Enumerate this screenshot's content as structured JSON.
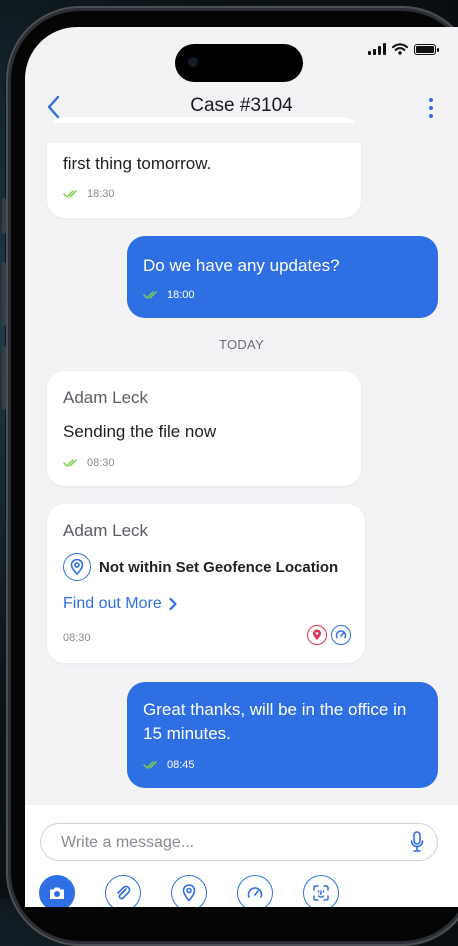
{
  "header": {
    "title": "Case #3104"
  },
  "messages": [
    {
      "direction": "incoming",
      "text": "first thing tomorrow.",
      "time": "18:30"
    },
    {
      "direction": "outgoing",
      "text": "Do we have any updates?",
      "time": "18:00"
    },
    {
      "direction": "incoming",
      "sender": "Adam Leck",
      "text": "Sending the file now",
      "time": "08:30"
    },
    {
      "direction": "incoming",
      "sender": "Adam Leck",
      "alert": "Not within Set Geofence Location",
      "link": "Find out More",
      "time": "08:30"
    },
    {
      "direction": "outgoing",
      "text": "Great thanks, will be in the office in 15 minutes.",
      "time": "08:45"
    }
  ],
  "day_separator": "TODAY",
  "composer": {
    "placeholder": "Write a message..."
  },
  "icons": {
    "back": "chevron-left-icon",
    "menu": "more-vertical-icon",
    "read": "double-check-icon",
    "geofence": "location-pin-icon",
    "link_arrow": "chevron-right-icon",
    "mic": "microphone-icon",
    "toolbar": [
      "camera-icon",
      "paperclip-icon",
      "location-pin-icon",
      "speedometer-icon",
      "face-scan-icon"
    ]
  },
  "colors": {
    "accent": "#2f6fe4",
    "read_tick": "#7ccf4b",
    "alert_red": "#e5324f",
    "background": "#f3f3f6"
  }
}
